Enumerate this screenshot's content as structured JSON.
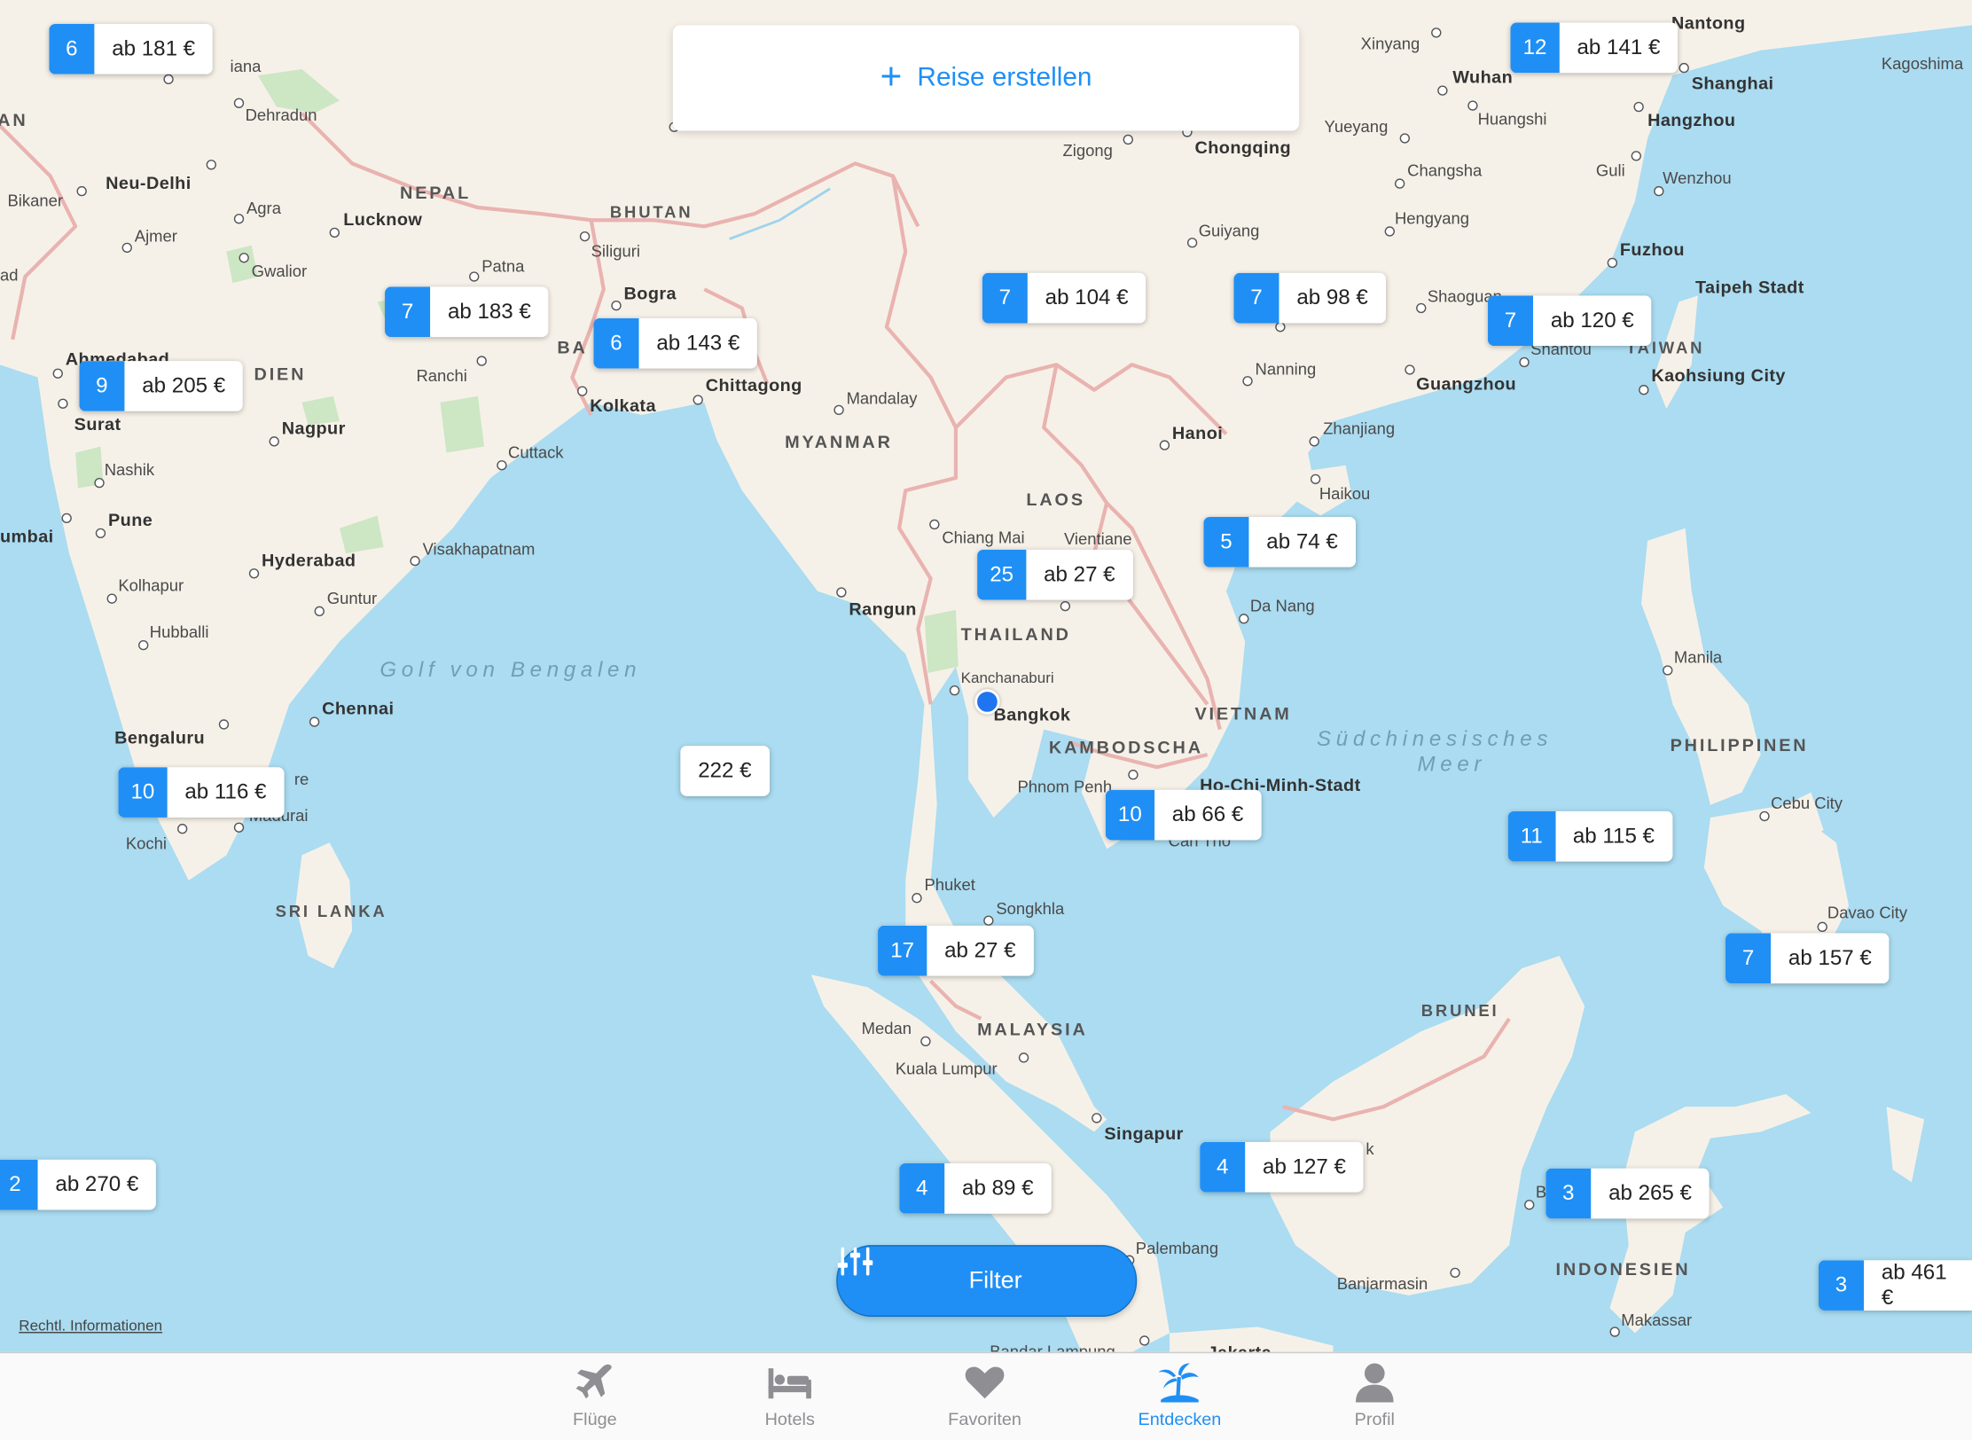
{
  "header": {
    "create_trip_label": "Reise erstellen"
  },
  "filter": {
    "label": "Filter"
  },
  "legal": {
    "label": "Rechtl. Informationen"
  },
  "map": {
    "countries": [
      "NEPAL",
      "BHUTAN",
      "MYANMAR",
      "LAOS",
      "THAILAND",
      "VIETNAM",
      "KAMBODSCHA",
      "MALAYSIA",
      "SRI LANKA",
      "PHILIPPINEN",
      "BRUNEI",
      "INDONESIEN",
      "TAIWAN",
      "DIEN",
      "AN",
      "BA"
    ],
    "seas": [
      "Golf von Bengalen",
      "Südchinesisches",
      "Meer"
    ],
    "cities": [
      "Dehradun",
      "Neu-Delhi",
      "Bikaner",
      "Agra",
      "Ajmer",
      "Lucknow",
      "Gwalior",
      "Patna",
      "Siliguri",
      "Bogra",
      "Ahmedabad",
      "Ranchi",
      "Kolkata",
      "Chittagong",
      "Mandalay",
      "Surat",
      "Nagpur",
      "Cuttack",
      "Nashik",
      "Pune",
      "umbai",
      "Hyderabad",
      "Visakhapatnam",
      "Kolhapur",
      "Guntur",
      "Hubballi",
      "Chennai",
      "Bengaluru",
      "Kochi",
      "Madurai",
      "re",
      "Rangun",
      "Chiang Mai",
      "Vientiane",
      "Kanchanaburi",
      "Bangkok",
      "Phnom Penh",
      "Ho-Chi-Minh-Stadt",
      "Can Tho",
      "Da Nang",
      "Hanoi",
      "Nanning",
      "Zhanjiang",
      "Haikou",
      "Guangzhou",
      "Shantou",
      "Kaohsiung City",
      "Taipeh Stadt",
      "Fuzhou",
      "Wenzhou",
      "Hangzhou",
      "Shanghai",
      "Nantong",
      "Kagoshima",
      "Wuhan",
      "Huangshi",
      "Xinyang",
      "Chongqing",
      "Zigong",
      "Yueyang",
      "Changsha",
      "Hengyang",
      "Guiyang",
      "Guli",
      "Shaoguan",
      "Manila",
      "Cebu City",
      "Davao City",
      "Phuket",
      "Songkhla",
      "Medan",
      "Kuala Lumpur",
      "Singapur",
      "Palembang",
      "Banjarmasin",
      "Makassar",
      "Jakarta",
      "Bandar Lampung",
      "iana",
      "ad",
      "B",
      "k"
    ],
    "price_pins": [
      {
        "count": "6",
        "price": "ab 181 €"
      },
      {
        "count": "12",
        "price": "ab 141 €"
      },
      {
        "count": "7",
        "price": "ab 183 €"
      },
      {
        "count": "6",
        "price": "ab 143 €"
      },
      {
        "count": "9",
        "price": "ab 205 €"
      },
      {
        "count": "7",
        "price": "ab 104 €"
      },
      {
        "count": "7",
        "price": "ab 98 €"
      },
      {
        "count": "7",
        "price": "ab 120 €"
      },
      {
        "count": "5",
        "price": "ab 74 €"
      },
      {
        "count": "25",
        "price": "ab 27 €"
      },
      {
        "count": "",
        "price": "222 €"
      },
      {
        "count": "10",
        "price": "ab 116 €"
      },
      {
        "count": "10",
        "price": "ab 66 €"
      },
      {
        "count": "11",
        "price": "ab 115 €"
      },
      {
        "count": "17",
        "price": "ab 27 €"
      },
      {
        "count": "7",
        "price": "ab 157 €"
      },
      {
        "count": "2",
        "price": "ab 270 €"
      },
      {
        "count": "4",
        "price": "ab 89 €"
      },
      {
        "count": "4",
        "price": "ab 127 €"
      },
      {
        "count": "3",
        "price": "ab 265 €"
      },
      {
        "count": "3",
        "price": "ab 461 €"
      }
    ]
  },
  "tabbar": {
    "items": [
      {
        "label": "Flüge",
        "icon": "plane-icon",
        "active": false
      },
      {
        "label": "Hotels",
        "icon": "bed-icon",
        "active": false
      },
      {
        "label": "Favoriten",
        "icon": "heart-icon",
        "active": false
      },
      {
        "label": "Entdecken",
        "icon": "palm-tree-icon",
        "active": true
      },
      {
        "label": "Profil",
        "icon": "person-icon",
        "active": false
      }
    ]
  },
  "colors": {
    "accent": "#1f8ff5",
    "water": "#abdcf1",
    "land": "#f6f1e8",
    "border": "#e9b3b0"
  }
}
